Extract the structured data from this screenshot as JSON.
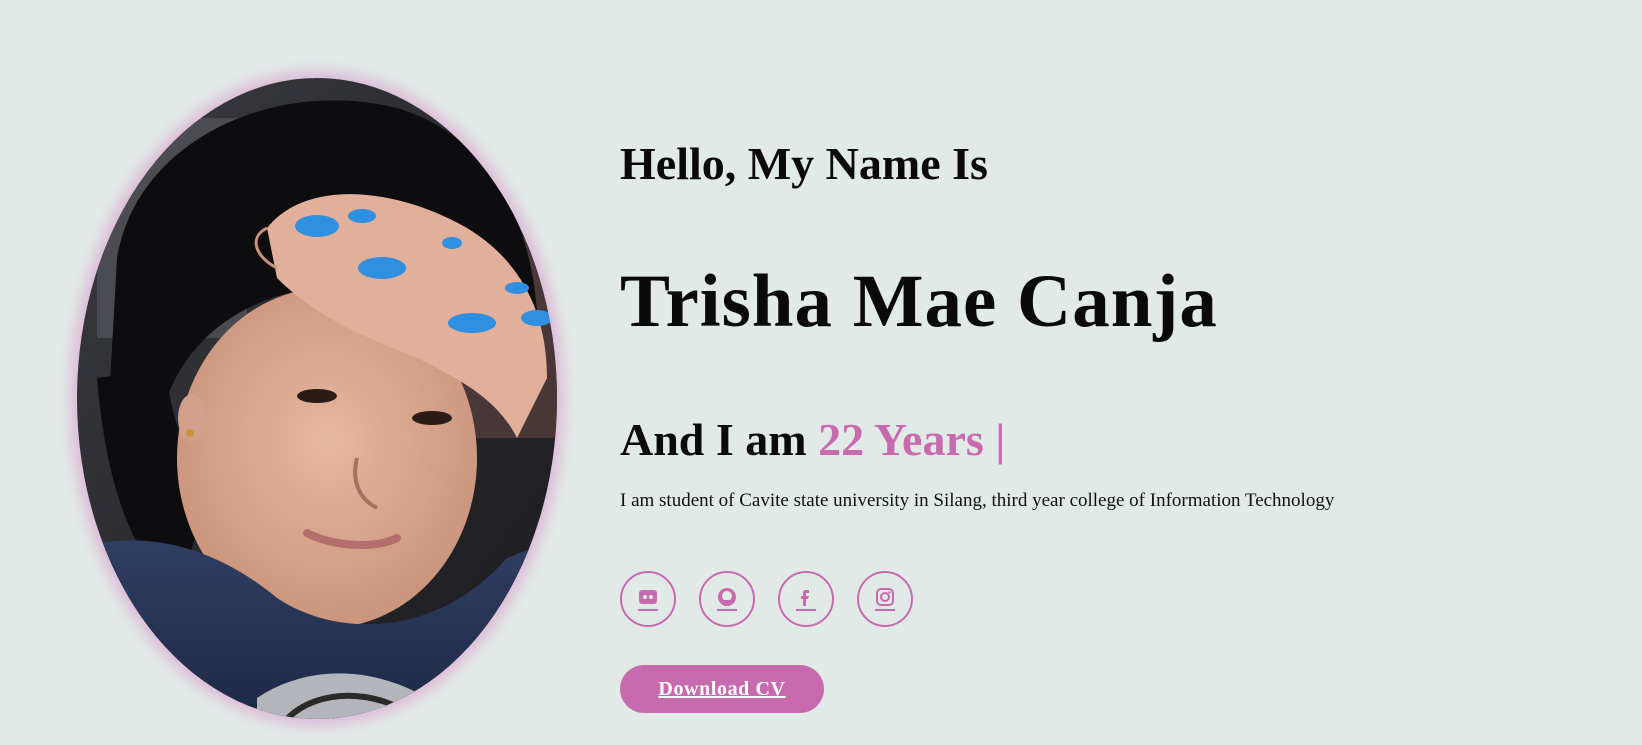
{
  "profile": {
    "photo_alt": "",
    "accent_color": "#c86bae",
    "background_color": "#e2eae8"
  },
  "hero": {
    "greeting": "Hello, My Name Is",
    "name": "Trisha Mae Canja",
    "age_prefix": "And I am ",
    "age_value": "22 Years |",
    "bio": "I am student of Cavite state university in Silang, third year college of Information Technology"
  },
  "socials": [
    {
      "icon": "discord-icon"
    },
    {
      "icon": "github-icon"
    },
    {
      "icon": "facebook-icon"
    },
    {
      "icon": "instagram-icon"
    }
  ],
  "cta": {
    "download_label": "Download CV"
  }
}
